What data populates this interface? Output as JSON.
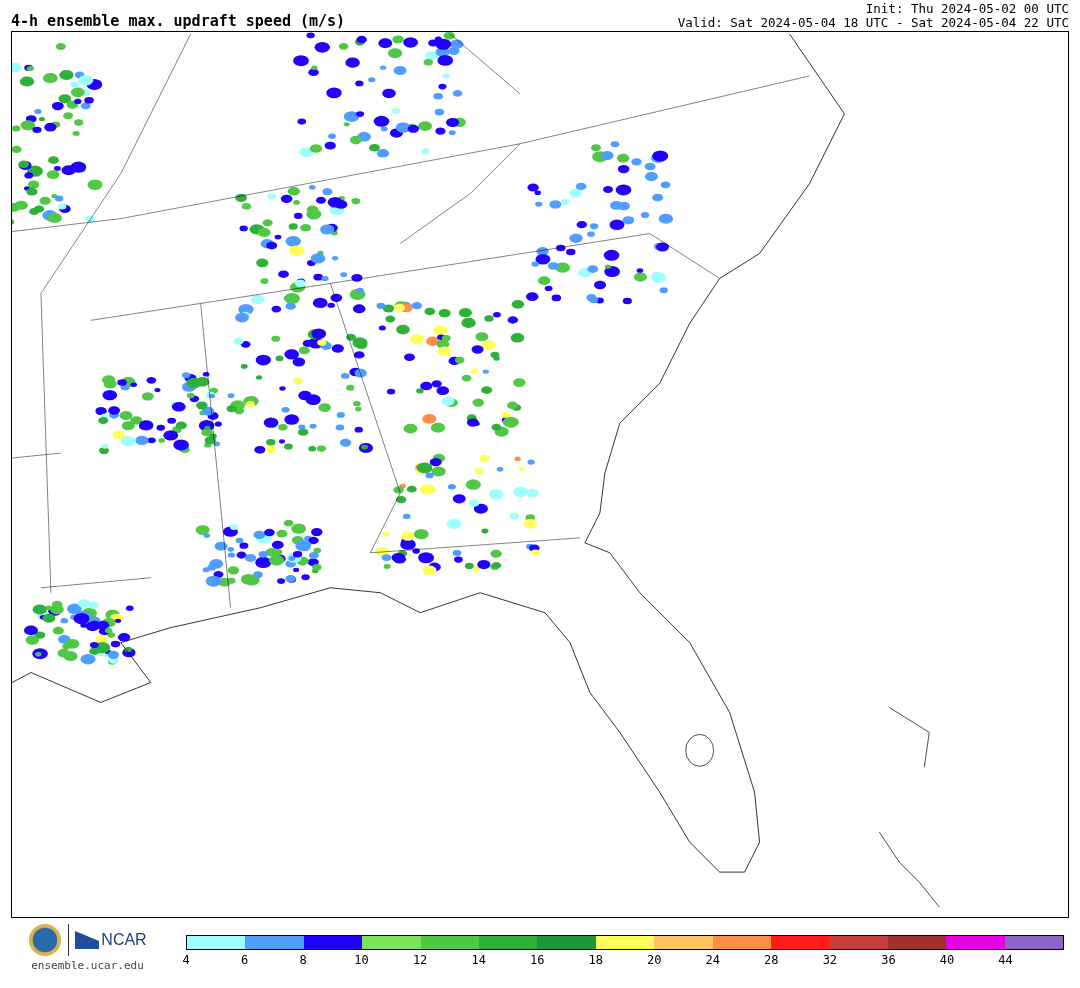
{
  "title": "4-h ensemble max. updraft speed (m/s)",
  "init": "Init: Thu 2024-05-02 00 UTC",
  "valid": "Valid: Sat 2024-05-04 18 UTC - Sat 2024-05-04 22 UTC",
  "logo": {
    "text": "NCAR",
    "site": "ensemble.ucar.edu"
  },
  "colorbar": {
    "bins": [
      {
        "color": "#9effff"
      },
      {
        "color": "#4f9dff"
      },
      {
        "color": "#2200ff"
      },
      {
        "color": "#7ce35a"
      },
      {
        "color": "#50c846"
      },
      {
        "color": "#2fb03a"
      },
      {
        "color": "#1f9637"
      },
      {
        "color": "#ffff5c"
      },
      {
        "color": "#ffc764"
      },
      {
        "color": "#ff8c4a"
      },
      {
        "color": "#ff1c1c"
      },
      {
        "color": "#c83c3c"
      },
      {
        "color": "#a03030"
      },
      {
        "color": "#e600e6"
      },
      {
        "color": "#8a64c8"
      }
    ],
    "ticks": [
      "4",
      "6",
      "8",
      "10",
      "12",
      "14",
      "16",
      "18",
      "20",
      "24",
      "28",
      "32",
      "36",
      "40",
      "44"
    ]
  }
}
